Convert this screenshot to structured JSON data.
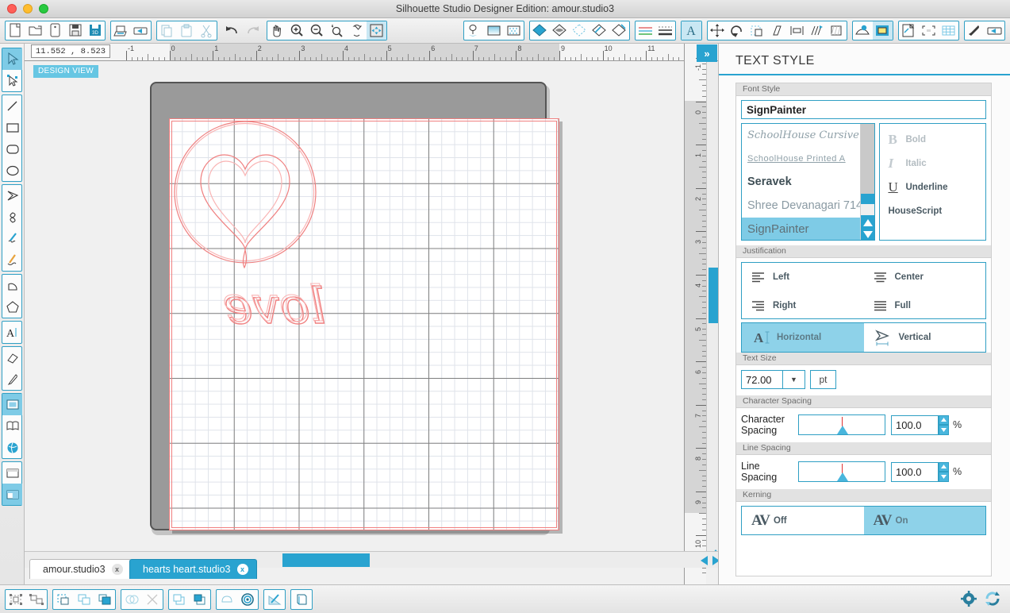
{
  "window": {
    "title": "Silhouette Studio Designer Edition: amour.studio3",
    "controls": [
      "close",
      "minimize",
      "zoom"
    ]
  },
  "toolbar": {
    "groups": [
      {
        "name": "file",
        "buttons": [
          {
            "icon": "new-document-icon",
            "label": "New"
          },
          {
            "icon": "open-folder-icon",
            "label": "Open"
          },
          {
            "icon": "new-from-library-icon",
            "label": "New From Library"
          },
          {
            "icon": "save-icon",
            "label": "Save"
          },
          {
            "icon": "save-as-icon",
            "label": "Save As"
          }
        ]
      },
      {
        "name": "print",
        "buttons": [
          {
            "icon": "print-icon",
            "label": "Print"
          },
          {
            "icon": "send-to-silhouette-icon",
            "label": "Send to Silhouette"
          }
        ]
      },
      {
        "name": "clipboard",
        "buttons": [
          {
            "icon": "copy-icon",
            "label": "Copy"
          },
          {
            "icon": "paste-icon",
            "label": "Paste"
          },
          {
            "icon": "cut-icon",
            "label": "Cut"
          }
        ]
      },
      {
        "name": "history",
        "buttons": [
          {
            "icon": "undo-icon",
            "label": "Undo"
          },
          {
            "icon": "redo-icon",
            "label": "Redo"
          }
        ]
      },
      {
        "name": "view",
        "buttons": [
          {
            "icon": "pan-hand-icon",
            "label": "Pan"
          },
          {
            "icon": "zoom-in-icon",
            "label": "Zoom In"
          },
          {
            "icon": "zoom-out-icon",
            "label": "Zoom Out"
          },
          {
            "icon": "zoom-selection-icon",
            "label": "Zoom to Selection"
          },
          {
            "icon": "fit-to-page-icon",
            "label": "Fit to Page"
          },
          {
            "icon": "fit-to-window-icon",
            "label": "Fit to Window",
            "selected": true
          }
        ]
      },
      {
        "name": "page",
        "buttons": [
          {
            "icon": "page-setup-icon",
            "label": "Page Setup"
          },
          {
            "icon": "gradient-fill-icon",
            "label": "Gradient"
          },
          {
            "icon": "pattern-fill-icon",
            "label": "Pattern Fill"
          }
        ]
      },
      {
        "name": "style",
        "buttons": [
          {
            "icon": "fill-color-icon",
            "label": "Fill Color"
          },
          {
            "icon": "line-color-icon",
            "label": "Line Color"
          },
          {
            "icon": "sketch-pen-icon",
            "label": "Sketch"
          },
          {
            "icon": "trace-icon",
            "label": "Trace"
          },
          {
            "icon": "offset-icon",
            "label": "Offset"
          }
        ]
      },
      {
        "name": "lines",
        "buttons": [
          {
            "icon": "line-style-icon",
            "label": "Line Style"
          },
          {
            "icon": "line-thickness-icon",
            "label": "Line Thickness"
          }
        ]
      },
      {
        "name": "text",
        "buttons": [
          {
            "icon": "text-style-icon",
            "label": "Text Style",
            "selected": true
          }
        ]
      },
      {
        "name": "transform",
        "buttons": [
          {
            "icon": "move-icon",
            "label": "Move"
          },
          {
            "icon": "rotate-icon",
            "label": "Rotate"
          },
          {
            "icon": "scale-icon",
            "label": "Scale"
          },
          {
            "icon": "shear-icon",
            "label": "Shear"
          },
          {
            "icon": "align-icon",
            "label": "Align"
          },
          {
            "icon": "replicate-icon",
            "label": "Replicate"
          },
          {
            "icon": "weld-icon",
            "label": "Weld"
          }
        ]
      },
      {
        "name": "library",
        "buttons": [
          {
            "icon": "store-icon",
            "label": "Silhouette Store"
          },
          {
            "icon": "my-library-icon",
            "label": "My Library",
            "selected": true
          }
        ]
      },
      {
        "name": "canvas",
        "buttons": [
          {
            "icon": "cut-settings-icon",
            "label": "Cut Settings"
          },
          {
            "icon": "registration-marks-icon",
            "label": "Registration Marks"
          },
          {
            "icon": "grid-settings-icon",
            "label": "Grid Settings"
          }
        ]
      },
      {
        "name": "output",
        "buttons": [
          {
            "icon": "pen-holder-icon",
            "label": "Pen Holder"
          },
          {
            "icon": "send-icon",
            "label": "Send"
          }
        ]
      }
    ]
  },
  "left_tools": {
    "groups": [
      {
        "name": "select",
        "tools": [
          {
            "icon": "arrow-select-icon",
            "label": "Select",
            "selected": true
          },
          {
            "icon": "edit-points-icon",
            "label": "Edit Points"
          }
        ]
      },
      {
        "name": "shapes",
        "tools": [
          {
            "icon": "line-tool-icon",
            "label": "Line"
          },
          {
            "icon": "rectangle-tool-icon",
            "label": "Rectangle"
          },
          {
            "icon": "rounded-rectangle-tool-icon",
            "label": "Rounded Rectangle"
          },
          {
            "icon": "ellipse-tool-icon",
            "label": "Ellipse"
          }
        ]
      },
      {
        "name": "draw",
        "tools": [
          {
            "icon": "polygon-tool-icon",
            "label": "Polygon"
          },
          {
            "icon": "curve-tool-icon",
            "label": "Curve"
          },
          {
            "icon": "freehand-tool-icon",
            "label": "Freehand"
          },
          {
            "icon": "smooth-freehand-tool-icon",
            "label": "Smooth Freehand"
          }
        ]
      },
      {
        "name": "arcs",
        "tools": [
          {
            "icon": "arc-tool-icon",
            "label": "Arc"
          },
          {
            "icon": "regular-polygon-tool-icon",
            "label": "Regular Polygon"
          }
        ]
      },
      {
        "name": "text",
        "tools": [
          {
            "icon": "text-tool-icon",
            "label": "Text"
          }
        ]
      },
      {
        "name": "erase",
        "tools": [
          {
            "icon": "eraser-tool-icon",
            "label": "Eraser"
          },
          {
            "icon": "knife-tool-icon",
            "label": "Knife"
          }
        ]
      },
      {
        "name": "panels",
        "tools": [
          {
            "icon": "design-page-icon",
            "label": "Design Page",
            "selected": true
          },
          {
            "icon": "library-icon",
            "label": "Library"
          },
          {
            "icon": "store-globe-icon",
            "label": "Store"
          }
        ]
      },
      {
        "name": "views",
        "tools": [
          {
            "icon": "single-view-icon",
            "label": "Single View"
          },
          {
            "icon": "split-view-icon",
            "label": "Split View",
            "selected": true
          }
        ]
      }
    ]
  },
  "canvas": {
    "coordinates": "11.552 , 8.523",
    "view_badge": "DESIGN VIEW",
    "ruler_h_labels": [
      "-1",
      "0",
      "1",
      "2",
      "3",
      "4",
      "5",
      "6",
      "7",
      "8",
      "9",
      "10",
      "11"
    ],
    "ruler_v_labels": [
      "-1",
      "0",
      "1",
      "2",
      "3",
      "4",
      "5",
      "6",
      "7",
      "8",
      "9",
      "10"
    ],
    "units": "in",
    "artwork": {
      "description": "mirrored heart-in-circle design with the word love",
      "text": "love",
      "stroke_color": "#f08080"
    }
  },
  "document_tabs": [
    {
      "label": "amour.studio3",
      "active": false,
      "close": "x"
    },
    {
      "label": "hearts heart.studio3",
      "active": true,
      "close": "x"
    }
  ],
  "panel": {
    "title": "TEXT STYLE",
    "accent_color": "#29a3d0",
    "font_style": {
      "header": "Font Style",
      "selected_font": "SignPainter",
      "font_list": [
        {
          "label": "SchoolHouse Cursive",
          "selected": false
        },
        {
          "label": "SchoolHouse Printed A",
          "selected": false
        },
        {
          "label": "Seravek",
          "selected": false
        },
        {
          "label": "Shree Devanagari 714",
          "selected": false
        },
        {
          "label": "SignPainter",
          "selected": true
        }
      ],
      "styles": [
        {
          "glyph": "B",
          "label": "Bold",
          "enabled": false
        },
        {
          "glyph": "I",
          "label": "Italic",
          "enabled": false
        },
        {
          "glyph": "U",
          "label": "Underline",
          "enabled": true
        },
        {
          "glyph": "",
          "label": "HouseScript",
          "enabled": true
        }
      ]
    },
    "justification": {
      "header": "Justification",
      "options": [
        {
          "label": "Left",
          "icon": "align-left-icon"
        },
        {
          "label": "Center",
          "icon": "align-center-icon"
        },
        {
          "label": "Right",
          "icon": "align-right-icon"
        },
        {
          "label": "Full",
          "icon": "align-justify-icon"
        }
      ],
      "orientation": [
        {
          "label": "Horizontal",
          "icon": "text-horizontal-icon",
          "selected": true
        },
        {
          "label": "Vertical",
          "icon": "text-vertical-icon",
          "selected": false
        }
      ]
    },
    "text_size": {
      "header": "Text Size",
      "value": "72.00",
      "unit": "pt"
    },
    "character_spacing": {
      "header": "Character Spacing",
      "label": "Character Spacing",
      "value": "100.0",
      "suffix": "%"
    },
    "line_spacing": {
      "header": "Line Spacing",
      "label": "Line Spacing",
      "value": "100.0",
      "suffix": "%"
    },
    "kerning": {
      "header": "Kerning",
      "options": [
        {
          "glyph": "AV",
          "label": "Off",
          "selected": false
        },
        {
          "glyph": "AV",
          "label": "On",
          "selected": true
        }
      ]
    },
    "collapse": "»"
  },
  "bottom_bar": {
    "groups": [
      {
        "name": "group",
        "buttons": [
          {
            "icon": "group-icon",
            "label": "Group"
          },
          {
            "icon": "ungroup-icon",
            "label": "Ungroup"
          }
        ]
      },
      {
        "name": "compound",
        "buttons": [
          {
            "icon": "make-compound-path-icon",
            "label": "Make Compound Path"
          },
          {
            "icon": "bring-forward-icon",
            "label": "Bring Forward"
          },
          {
            "icon": "bring-to-front-icon",
            "label": "Bring To Front"
          }
        ]
      },
      {
        "name": "modify",
        "buttons": [
          {
            "icon": "weld-shapes-icon",
            "label": "Weld"
          },
          {
            "icon": "detach-icon",
            "label": "Detach Lines"
          }
        ]
      },
      {
        "name": "arrange",
        "buttons": [
          {
            "icon": "send-backward-icon",
            "label": "Send Backward"
          },
          {
            "icon": "send-to-back-icon",
            "label": "Send To Back"
          }
        ]
      },
      {
        "name": "effects",
        "buttons": [
          {
            "icon": "shadow-icon",
            "label": "Shadow"
          },
          {
            "icon": "offset-rings-icon",
            "label": "Offset"
          }
        ]
      },
      {
        "name": "sketch",
        "buttons": [
          {
            "icon": "sketch-pen-fill-icon",
            "label": "Sketch Fill"
          }
        ]
      },
      {
        "name": "modify2",
        "buttons": [
          {
            "icon": "modify-icon",
            "label": "Modify"
          }
        ]
      }
    ],
    "right_icons": [
      {
        "icon": "gear-icon",
        "label": "Preferences"
      },
      {
        "icon": "sync-icon",
        "label": "Sync"
      }
    ]
  }
}
